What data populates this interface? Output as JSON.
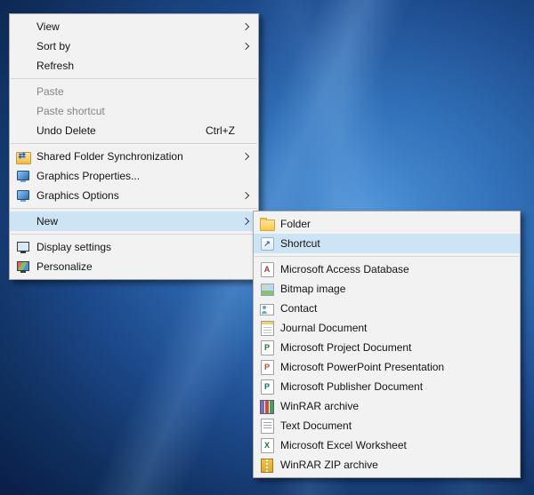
{
  "colors": {
    "menu_bg": "#f2f2f2",
    "menu_border": "#a8a8a8",
    "highlight": "#cde4f5",
    "disabled_text": "#858585",
    "wallpaper_dark": "#0a1f49",
    "wallpaper_light": "#4f93d8"
  },
  "context_menu": {
    "items": [
      {
        "label": "View",
        "has_submenu": true
      },
      {
        "label": "Sort by",
        "has_submenu": true
      },
      {
        "label": "Refresh"
      },
      {
        "label": "Paste",
        "disabled": true
      },
      {
        "label": "Paste shortcut",
        "disabled": true
      },
      {
        "label": "Undo Delete",
        "shortcut": "Ctrl+Z"
      },
      {
        "label": "Shared Folder Synchronization",
        "icon": "sync-icon",
        "has_submenu": true
      },
      {
        "label": "Graphics Properties...",
        "icon": "graphics-icon"
      },
      {
        "label": "Graphics Options",
        "icon": "graphics-icon",
        "has_submenu": true
      },
      {
        "label": "New",
        "has_submenu": true,
        "highlighted": true
      },
      {
        "label": "Display settings",
        "icon": "display-icon"
      },
      {
        "label": "Personalize",
        "icon": "personalize-icon"
      }
    ]
  },
  "submenu": {
    "items": [
      {
        "label": "Folder",
        "icon": "folder-icon"
      },
      {
        "label": "Shortcut",
        "icon": "shortcut-icon",
        "highlighted": true
      },
      {
        "label": "Microsoft Access Database",
        "icon": "access-database-icon"
      },
      {
        "label": "Bitmap image",
        "icon": "bitmap-image-icon"
      },
      {
        "label": "Contact",
        "icon": "contact-icon"
      },
      {
        "label": "Journal Document",
        "icon": "journal-icon"
      },
      {
        "label": "Microsoft Project Document",
        "icon": "project-icon"
      },
      {
        "label": "Microsoft PowerPoint Presentation",
        "icon": "powerpoint-icon"
      },
      {
        "label": "Microsoft Publisher Document",
        "icon": "publisher-icon"
      },
      {
        "label": "WinRAR archive",
        "icon": "winrar-icon"
      },
      {
        "label": "Text Document",
        "icon": "text-document-icon"
      },
      {
        "label": "Microsoft Excel Worksheet",
        "icon": "excel-icon"
      },
      {
        "label": "WinRAR ZIP archive",
        "icon": "winrar-zip-icon"
      }
    ]
  },
  "icons": {
    "access_letter": "A",
    "project_letter": "P",
    "powerpoint_letter": "P",
    "publisher_letter": "P",
    "excel_letter": "X"
  }
}
